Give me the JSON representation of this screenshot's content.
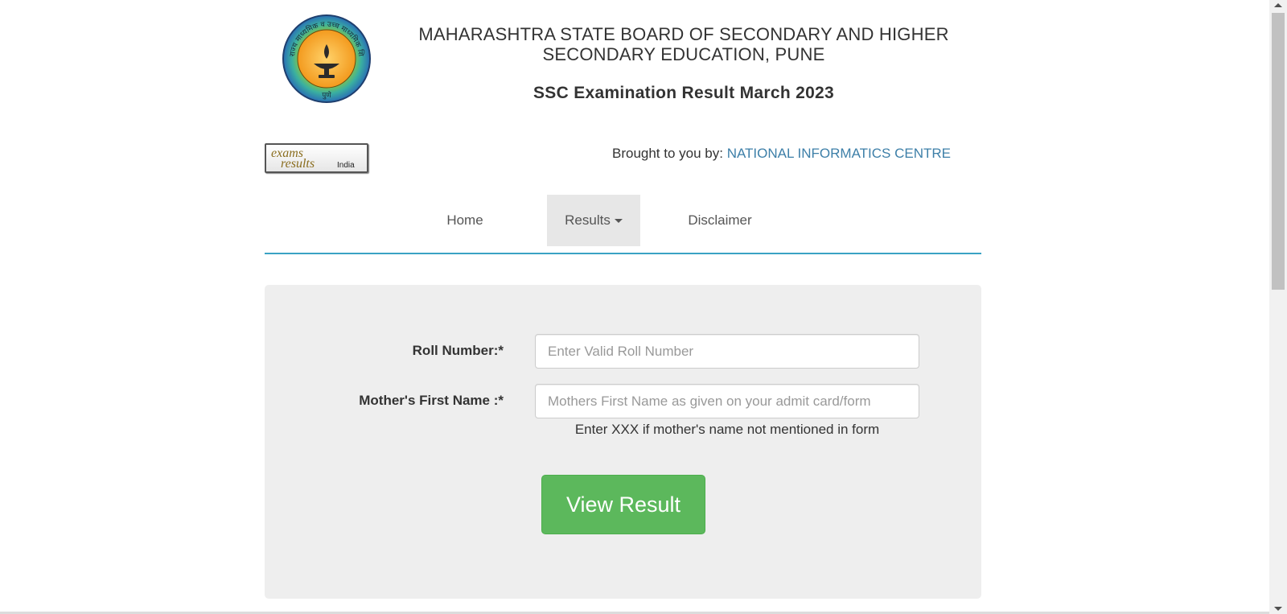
{
  "header": {
    "board_line1": "MAHARASHTRA STATE BOARD OF SECONDARY AND HIGHER",
    "board_line2": "SECONDARY EDUCATION, PUNE",
    "exam_title": "SSC Examination Result March 2023"
  },
  "seal": {
    "ring_text": "राज्य माध्यमिक व उच्च माध्यमिक शिक्षण मंडळ",
    "bottom_text": "पुणे",
    "colors": {
      "outer": "#2a6fb5",
      "ring": "#3ab0a0",
      "ring_alt": "#8cc63f",
      "center": "#f6a623"
    }
  },
  "brand_logo": {
    "word1": "exams",
    "word2": "results",
    "word3": "India",
    "color": "#8a6d1e"
  },
  "credit": {
    "prefix": "Brought to you by: ",
    "org": "NATIONAL INFORMATICS CENTRE",
    "org_color": "#3d7fa8"
  },
  "nav": {
    "home": "Home",
    "results": "Results",
    "disclaimer": "Disclaimer",
    "active": "Results",
    "underline_color": "#3aa3c4"
  },
  "form": {
    "roll_label": "Roll Number:*",
    "roll_placeholder": "Enter Valid Roll Number",
    "roll_value": "",
    "mother_label": "Mother's First Name :*",
    "mother_placeholder": "Mothers First Name as given on your admit card/form",
    "mother_value": "",
    "mother_help": "Enter XXX if mother's name not mentioned in form",
    "submit_label": "View Result",
    "submit_color": "#5cb85c"
  }
}
